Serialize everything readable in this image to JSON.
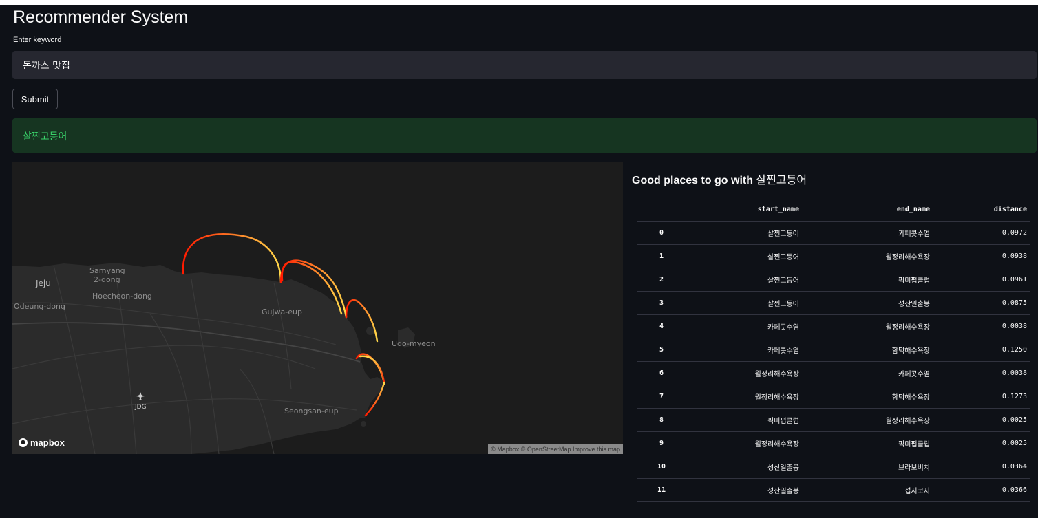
{
  "app": {
    "title": "Recommender System"
  },
  "search": {
    "label": "Enter keyword",
    "value": "돈까스 맛집",
    "submit_label": "Submit"
  },
  "result": {
    "message": "살찐고등어"
  },
  "map": {
    "labels": {
      "jeju": "Jeju",
      "samyang": "Samyang",
      "samyang2": "2-dong",
      "hoecheon": "Hoecheon-dong",
      "odeung": "Odeung-dong",
      "gujwa": "Gujwa-eup",
      "udo": "Udo-myeon",
      "jdg": "JDG",
      "seongsan": "Seongsan-eup"
    },
    "logo": "mapbox",
    "attribution": "© Mapbox © OpenStreetMap Improve this map",
    "arc_colors": {
      "start": "#ff0000",
      "end": "#ffd23f"
    }
  },
  "table": {
    "title_prefix": "Good places to go with ",
    "title_place": "살찐고등어",
    "columns": [
      "",
      "start_name",
      "end_name",
      "distance"
    ],
    "rows": [
      [
        "0",
        "살찐고등어",
        "카페콧수염",
        "0.0972"
      ],
      [
        "1",
        "살찐고등어",
        "월정리해수욕장",
        "0.0938"
      ],
      [
        "2",
        "살찐고등어",
        "픽미펍클럽",
        "0.0961"
      ],
      [
        "3",
        "살찐고등어",
        "성산일출봉",
        "0.0875"
      ],
      [
        "4",
        "카페콧수염",
        "월정리해수욕장",
        "0.0038"
      ],
      [
        "5",
        "카페콧수염",
        "함덕해수욕장",
        "0.1250"
      ],
      [
        "6",
        "월정리해수욕장",
        "카페콧수염",
        "0.0038"
      ],
      [
        "7",
        "월정리해수욕장",
        "함덕해수욕장",
        "0.1273"
      ],
      [
        "8",
        "픽미펍클럽",
        "월정리해수욕장",
        "0.0025"
      ],
      [
        "9",
        "월정리해수욕장",
        "픽미펍클럽",
        "0.0025"
      ],
      [
        "10",
        "성산일출봉",
        "브라보비치",
        "0.0364"
      ],
      [
        "11",
        "성산일출봉",
        "섭지코지",
        "0.0366"
      ]
    ]
  },
  "colors": {
    "background": "#0e1117",
    "input_bg": "#262730",
    "success_bg": "#163521",
    "success_text": "#39d36a"
  }
}
